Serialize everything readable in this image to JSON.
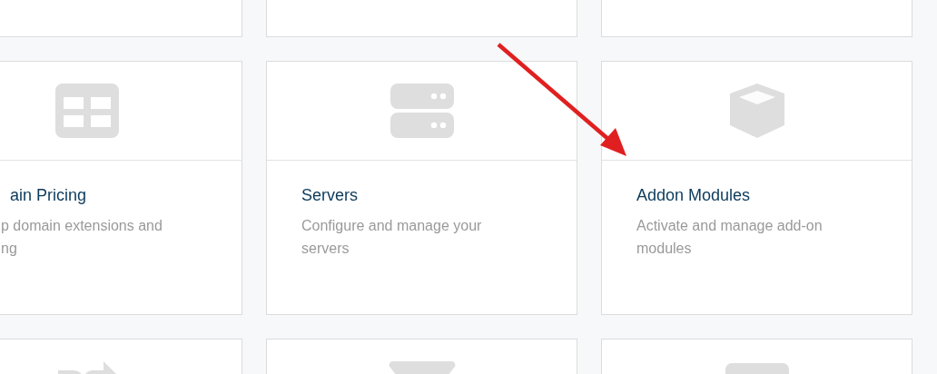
{
  "rows": [
    {
      "cards": [
        {
          "kind": "blank"
        },
        {
          "kind": "blank"
        },
        {
          "kind": "blank"
        }
      ]
    },
    {
      "cards": [
        {
          "kind": "clipped",
          "title": "ain Pricing",
          "description": "p domain extensions and ng"
        },
        {
          "kind": "full",
          "title": "Servers",
          "description": "Configure and manage your servers"
        },
        {
          "kind": "full",
          "title": "Addon Modules",
          "description": "Activate and manage add-on modules"
        }
      ]
    },
    {
      "cards": [
        {
          "kind": "icon-only"
        },
        {
          "kind": "icon-only"
        },
        {
          "kind": "icon-only"
        }
      ]
    }
  ],
  "annotation": {
    "kind": "arrow",
    "color": "#e02020"
  }
}
